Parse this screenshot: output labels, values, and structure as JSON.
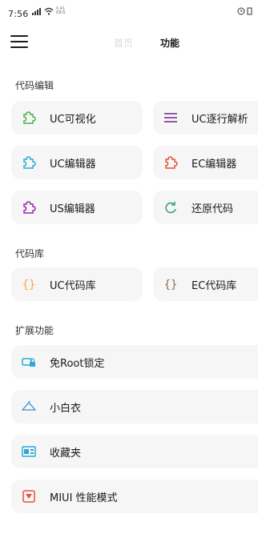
{
  "status": {
    "time": "7:56",
    "speed": "0.41 KB/S"
  },
  "tabs": {
    "home": "首页",
    "function": "功能"
  },
  "sections": {
    "code_edit": {
      "title": "代码编辑",
      "items": [
        {
          "label": "UC可视化",
          "icon": "puzzle-icon",
          "color": "#4caf50"
        },
        {
          "label": "UC逐行解析",
          "icon": "list-icon",
          "color": "#8e5aa6"
        },
        {
          "label": "UC编辑器",
          "icon": "puzzle-icon",
          "color": "#2aa8d8"
        },
        {
          "label": "EC编辑器",
          "icon": "puzzle-icon",
          "color": "#e0533c"
        },
        {
          "label": "US编辑器",
          "icon": "puzzle-icon",
          "color": "#9c27b0"
        },
        {
          "label": "还原代码",
          "icon": "refresh-icon",
          "color": "#3aa37a"
        }
      ]
    },
    "code_lib": {
      "title": "代码库",
      "items": [
        {
          "label": "UC代码库",
          "icon": "braces-icon",
          "color": "#f2a93b"
        },
        {
          "label": "EC代码库",
          "icon": "braces-icon",
          "color": "#8a6a5a"
        }
      ]
    },
    "extensions": {
      "title": "扩展功能",
      "items": [
        {
          "label": "免Root锁定",
          "icon": "lock-icon",
          "color": "#2aa8d8"
        },
        {
          "label": "小白衣",
          "icon": "hanger-icon",
          "color": "#3b8fd4"
        },
        {
          "label": "收藏夹",
          "icon": "favorites-icon",
          "color": "#2aa8d8"
        },
        {
          "label": "MIUI 性能模式",
          "icon": "chip-icon",
          "color": "#e0533c"
        }
      ]
    }
  }
}
